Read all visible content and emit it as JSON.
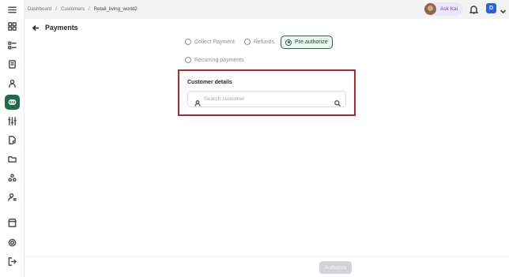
{
  "breadcrumb": [
    "Dashboard",
    "Customers",
    "Retail_living_world2"
  ],
  "header": {
    "ask_label": "Ask Kai",
    "user_initial": "D"
  },
  "page": {
    "title": "Payments"
  },
  "payment_types": [
    {
      "label": "Collect Payment",
      "selected": false
    },
    {
      "label": "Refunds",
      "selected": false
    },
    {
      "label": "Pre authorize",
      "selected": true
    },
    {
      "label": "Recurring payments",
      "selected": false
    }
  ],
  "customer": {
    "section_label": "Customer details",
    "search_placeholder": "Search customer"
  },
  "footer": {
    "authorize_label": "Authorize"
  },
  "colors": {
    "accent": "#1f6b4a",
    "highlight": "#b8242a",
    "ask_kai": "#6a3fc4",
    "user_badge": "#2c63d6"
  }
}
